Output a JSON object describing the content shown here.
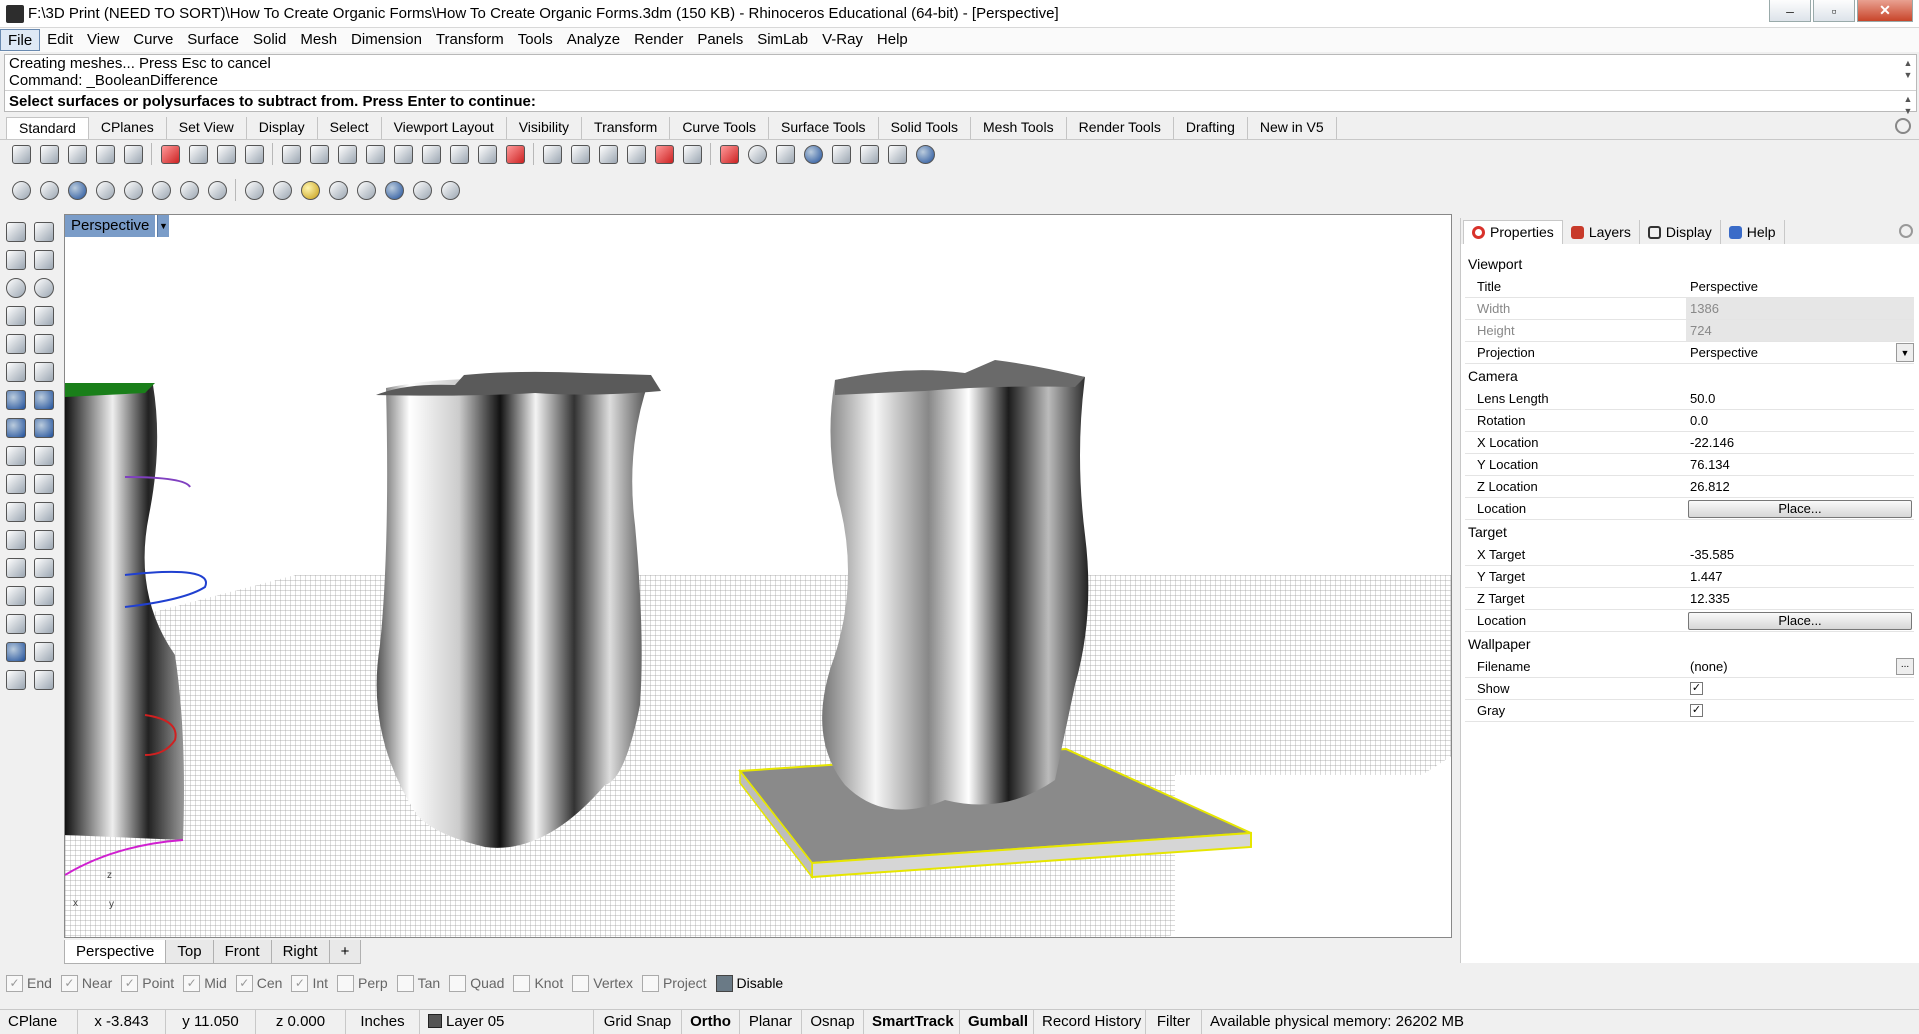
{
  "window": {
    "title": "F:\\3D Print (NEED TO SORT)\\How To Create Organic Forms\\How To Create Organic Forms.3dm (150 KB) - Rhinoceros Educational (64-bit) - [Perspective]",
    "buttons": {
      "minimize": "–",
      "maximize": "▫",
      "close": "✕"
    }
  },
  "menu": [
    "File",
    "Edit",
    "View",
    "Curve",
    "Surface",
    "Solid",
    "Mesh",
    "Dimension",
    "Transform",
    "Tools",
    "Analyze",
    "Render",
    "Panels",
    "SimLab",
    "V-Ray",
    "Help"
  ],
  "command": {
    "history": [
      "Creating meshes... Press Esc to cancel",
      "Command: _BooleanDifference"
    ],
    "prompt": "Select surfaces or polysurfaces to subtract from. Press Enter to continue:"
  },
  "toolbar_tabs": [
    "Standard",
    "CPlanes",
    "Set View",
    "Display",
    "Select",
    "Viewport Layout",
    "Visibility",
    "Transform",
    "Curve Tools",
    "Surface Tools",
    "Solid Tools",
    "Mesh Tools",
    "Render Tools",
    "Drafting",
    "New in V5"
  ],
  "toolbar_row1_icons": [
    "new-file-icon",
    "open-icon",
    "save-icon",
    "print-icon",
    "import-icon",
    "cut-icon",
    "copy-icon",
    "paste-icon",
    "undo-icon",
    "pan-icon",
    "rotate-view-icon",
    "zoom-dynamic-icon",
    "zoom-window-icon",
    "zoom-extents-icon",
    "zoom-selected-icon",
    "undo-view-icon",
    "four-viewports-icon",
    "car-icon",
    "properties-icon",
    "options-icon",
    "select-all-icon",
    "light-icon",
    "lock-icon",
    "layers-icon",
    "color-wheel-icon",
    "render-sphere-icon",
    "material-icon",
    "environment-icon",
    "gumball-icon",
    "settings-icon",
    "history-icon",
    "help-icon"
  ],
  "toolbar_row2_icons": [
    "wireframe-icon",
    "shaded-icon",
    "rendered-icon",
    "ghosted-icon",
    "xray-icon",
    "technical-icon",
    "artistic-icon",
    "pen-icon",
    "shaded-globe-icon",
    "sphere-icon",
    "gold-sphere-icon",
    "target-icon",
    "cameras-icon",
    "environment-tool-icon",
    "sun-icon",
    "monitor-icon"
  ],
  "left_tools": [
    "select-arrow-icon",
    "point-icon",
    "polyline-icon",
    "curve-control-icon",
    "circle-icon",
    "ellipse-icon",
    "arc-icon",
    "rectangle-icon",
    "polygon-icon",
    "freeform-icon",
    "surface-icon",
    "sweep-icon",
    "solid-box-icon",
    "boolean-icon",
    "cylinder-icon",
    "mesh-icon",
    "fillet-icon",
    "explode-icon",
    "trim-icon",
    "split-icon",
    "join-icon",
    "group-icon",
    "transform-icon",
    "mirror-icon",
    "text-icon",
    "dimension-icon",
    "array-icon",
    "scale-icon",
    "block-icon",
    "analysis-icon",
    "render-tool-icon",
    "check-icon",
    "drafting-icon",
    "extra-tools-icon"
  ],
  "viewport": {
    "title": "Perspective",
    "axis": {
      "x": "x",
      "y": "y",
      "z": "z"
    },
    "tabs": [
      "Perspective",
      "Top",
      "Front",
      "Right",
      "+"
    ]
  },
  "panel": {
    "tabs": [
      {
        "label": "Properties",
        "color": "#d8322b"
      },
      {
        "label": "Layers",
        "color": "#c83a2a"
      },
      {
        "label": "Display",
        "color": "#333333"
      },
      {
        "label": "Help",
        "color": "#3a6bc8"
      }
    ],
    "sections": [
      {
        "title": "Viewport",
        "rows": [
          {
            "key": "Title",
            "value": "Perspective"
          },
          {
            "key": "Width",
            "value": "1386",
            "disabled": true
          },
          {
            "key": "Height",
            "value": "724",
            "disabled": true
          },
          {
            "key": "Projection",
            "value": "Perspective",
            "dropdown": true
          }
        ]
      },
      {
        "title": "Camera",
        "rows": [
          {
            "key": "Lens Length",
            "value": "50.0"
          },
          {
            "key": "Rotation",
            "value": "0.0"
          },
          {
            "key": "X Location",
            "value": "-22.146"
          },
          {
            "key": "Y Location",
            "value": "76.134"
          },
          {
            "key": "Z Location",
            "value": "26.812"
          },
          {
            "key": "Location",
            "button": "Place..."
          }
        ]
      },
      {
        "title": "Target",
        "rows": [
          {
            "key": "X Target",
            "value": "-35.585"
          },
          {
            "key": "Y Target",
            "value": "1.447"
          },
          {
            "key": "Z Target",
            "value": "12.335"
          },
          {
            "key": "Location",
            "button": "Place..."
          }
        ]
      },
      {
        "title": "Wallpaper",
        "rows": [
          {
            "key": "Filename",
            "value": "(none)",
            "dots": "..."
          },
          {
            "key": "Show",
            "check": "✓"
          },
          {
            "key": "Gray",
            "check": "✓"
          }
        ]
      }
    ]
  },
  "osnap": [
    {
      "label": "End",
      "checked": true
    },
    {
      "label": "Near",
      "checked": true
    },
    {
      "label": "Point",
      "checked": true
    },
    {
      "label": "Mid",
      "checked": true
    },
    {
      "label": "Cen",
      "checked": true
    },
    {
      "label": "Int",
      "checked": true
    },
    {
      "label": "Perp",
      "checked": false
    },
    {
      "label": "Tan",
      "checked": false
    },
    {
      "label": "Quad",
      "checked": false
    },
    {
      "label": "Knot",
      "checked": false
    },
    {
      "label": "Vertex",
      "checked": false
    },
    {
      "label": "Project",
      "checked": false
    },
    {
      "label": "Disable",
      "checked": false,
      "disable": true
    }
  ],
  "status": {
    "cplane": "CPlane",
    "x": "x -3.843",
    "y": "y 11.050",
    "z": "z 0.000",
    "units": "Inches",
    "layer": "Layer 05",
    "toggles": [
      {
        "label": "Grid Snap",
        "bold": false
      },
      {
        "label": "Ortho",
        "bold": true
      },
      {
        "label": "Planar",
        "bold": false
      },
      {
        "label": "Osnap",
        "bold": false
      },
      {
        "label": "SmartTrack",
        "bold": true
      },
      {
        "label": "Gumball",
        "bold": true
      },
      {
        "label": "Record History",
        "bold": false
      },
      {
        "label": "Filter",
        "bold": false
      }
    ],
    "memory": "Available physical memory: 26202 MB"
  },
  "colors": {
    "viewport_title_bg": "#7a9cc8",
    "selection": "#e6e600",
    "grid": "#9a9a9a"
  }
}
